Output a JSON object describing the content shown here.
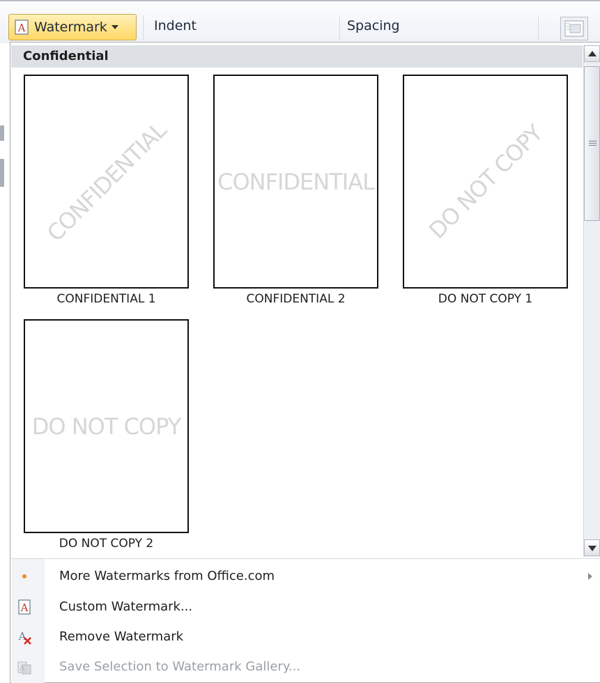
{
  "ribbon": {
    "watermark_label": "Watermark",
    "indent_label": "Indent",
    "spacing_label": "Spacing"
  },
  "gallery": {
    "category": "Confidential",
    "items": [
      {
        "caption": "CONFIDENTIAL 1",
        "text": "CONFIDENTIAL",
        "orientation": "diagonal"
      },
      {
        "caption": "CONFIDENTIAL 2",
        "text": "CONFIDENTIAL",
        "orientation": "horizontal"
      },
      {
        "caption": "DO NOT COPY 1",
        "text": "DO NOT COPY",
        "orientation": "diagonal"
      },
      {
        "caption": "DO NOT COPY 2",
        "text": "DO NOT COPY",
        "orientation": "horizontal"
      }
    ]
  },
  "menu": {
    "items": [
      {
        "label": "More Watermarks from Office.com",
        "icon": "bullet-dot-icon",
        "disabled": false,
        "has_submenu": true
      },
      {
        "label": "Custom Watermark...",
        "icon": "custom-watermark-icon",
        "disabled": false
      },
      {
        "label": "Remove Watermark",
        "icon": "remove-watermark-icon",
        "disabled": false
      },
      {
        "label": "Save Selection to Watermark Gallery...",
        "icon": "save-gallery-icon",
        "disabled": true
      }
    ]
  },
  "colors": {
    "accent_button": "#ffd865",
    "watermark_text": "#d6d6d6",
    "disabled_text": "#9aa0a6",
    "category_header": "#dde1e6",
    "bullet_orange": "#f08a24"
  }
}
